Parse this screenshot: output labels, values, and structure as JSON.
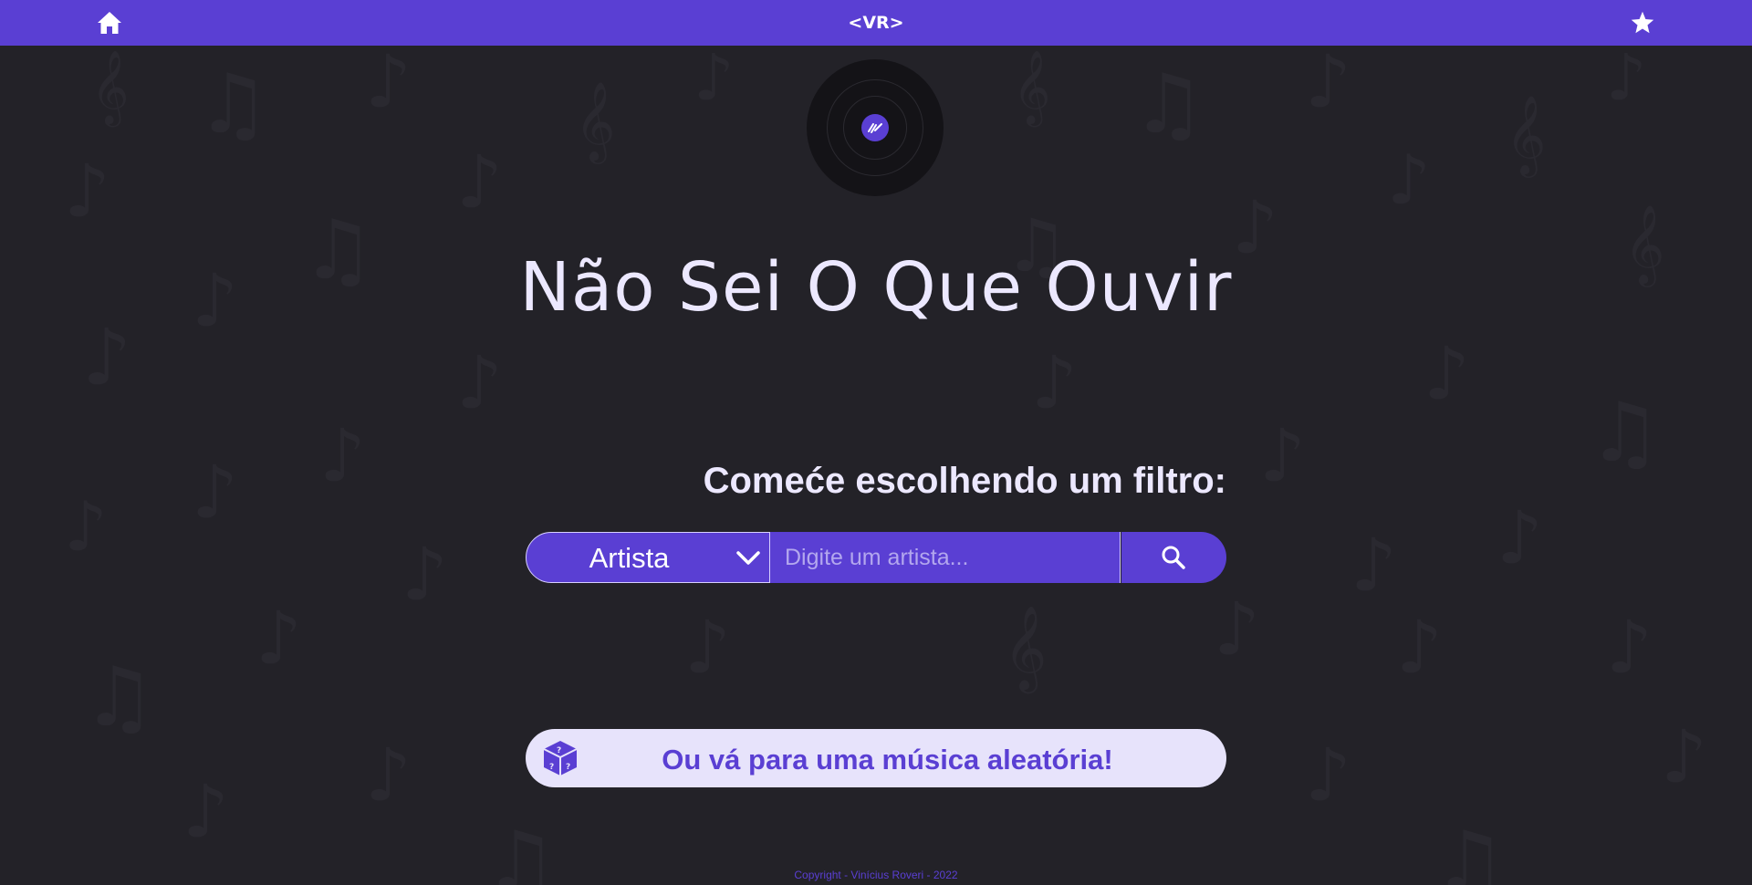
{
  "header": {
    "home_icon": "home-icon",
    "brand": "<VR>",
    "favorites_icon": "star-icon"
  },
  "hero": {
    "logo_icon": "vinyl-record-icon",
    "title": "Não Sei O Que Ouvir"
  },
  "search": {
    "prompt": "Comeće escolhendo um filtro:",
    "filter_selected": "Artista",
    "input_value": "",
    "input_placeholder": "Digite um artista...",
    "search_icon": "search-icon"
  },
  "random": {
    "icon": "dice-icon",
    "label": "Ou vá para uma música aleatória!"
  },
  "footer": {
    "copyright": "Copyright - Vinícius Roveri - 2022"
  },
  "colors": {
    "accent": "#5a3fd3",
    "background": "#232228",
    "text": "#ece8ff",
    "random_button_bg": "#e7e3fb"
  }
}
